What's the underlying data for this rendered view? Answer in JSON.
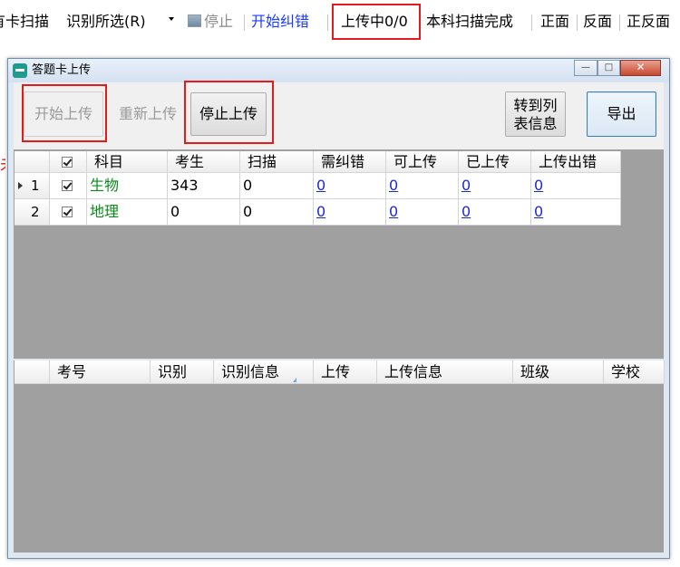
{
  "toolbar": {
    "card_scan": "有卡扫描",
    "recognize_selected": "识别所选(R)",
    "stop": "停止",
    "start_correct": "开始纠错",
    "uploading_status": "上传中0/0",
    "subject_scan_done": "本科扫描完成",
    "front": "正面",
    "back": "反面",
    "both_sides": "正反面"
  },
  "fragment_text": "未",
  "dialog": {
    "title": "答题卡上传",
    "buttons": {
      "start_upload": "开始上传",
      "reupload": "重新上传",
      "stop_upload": "停止上传",
      "to_list_line1": "转到列",
      "to_list_line2": "表信息",
      "export": "导出"
    },
    "window_controls": {
      "minimize": "—",
      "maximize": "□",
      "close": "✕"
    },
    "upper_grid": {
      "columns": [
        "科目",
        "考生",
        "扫描",
        "需纠错",
        "可上传",
        "已上传",
        "上传出错"
      ],
      "rows": [
        {
          "num": "1",
          "subject": "生物",
          "students": "343",
          "scanned": "0",
          "need_correct": "0",
          "can_upload": "0",
          "uploaded": "0",
          "upload_error": "0"
        },
        {
          "num": "2",
          "subject": "地理",
          "students": "0",
          "scanned": "0",
          "need_correct": "0",
          "can_upload": "0",
          "uploaded": "0",
          "upload_error": "0"
        }
      ]
    },
    "lower_grid": {
      "columns": [
        "考号",
        "识别",
        "识别信息",
        "上传",
        "上传信息",
        "班级",
        "学校"
      ]
    }
  },
  "colors": {
    "highlight_red": "#e21b1b",
    "link_blue": "#1a2bd6",
    "subject_green": "#0a8a1a",
    "grid_bg": "#a0a0a0"
  }
}
